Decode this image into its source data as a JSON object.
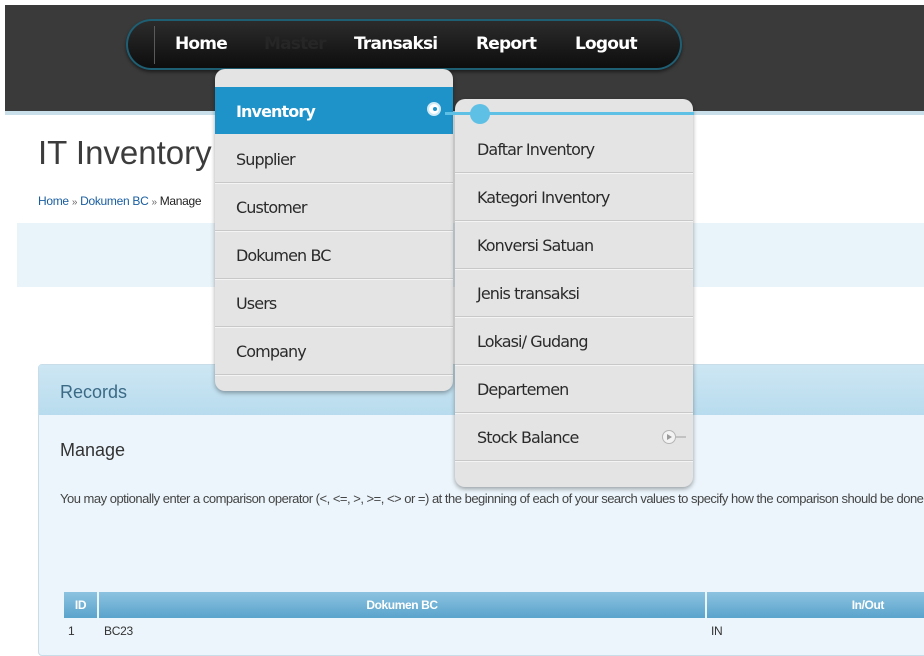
{
  "nav": {
    "items": [
      "Home",
      "Master",
      "Transaksi",
      "Report",
      "Logout"
    ]
  },
  "page": {
    "title": "IT Inventory",
    "breadcrumb": [
      "Home",
      "Dokumen BC",
      "Manage"
    ],
    "breadcrumb_sep": "»"
  },
  "records": {
    "title": "Records",
    "subtitle": "Manage",
    "hint": "You may optionally enter a comparison operator (<, <=, >, >=, <> or =) at the beginning of each of your search values to specify how the comparison should be done."
  },
  "table": {
    "columns": [
      "ID",
      "Dokumen BC",
      "In/Out"
    ],
    "rows": [
      {
        "id": "1",
        "dokumen": "BC23",
        "inout": "IN"
      }
    ]
  },
  "master_menu": {
    "items": [
      "Inventory",
      "Supplier",
      "Customer",
      "Dokumen BC",
      "Users",
      "Company"
    ],
    "active": "Inventory"
  },
  "inventory_submenu": {
    "items": [
      "Daftar Inventory",
      "Kategori Inventory",
      "Konversi Satuan",
      "Jenis transaksi",
      "Lokasi/ Gudang",
      "Departemen",
      "Stock Balance"
    ]
  },
  "colors": {
    "active_blue": "#1d93ca",
    "connector_blue": "#5fc0e6",
    "nav_dark": "#0c0c0c"
  },
  "icons": {
    "active_item": "circle-arrow-icon",
    "submenu": "chevron-right-circle-icon"
  }
}
